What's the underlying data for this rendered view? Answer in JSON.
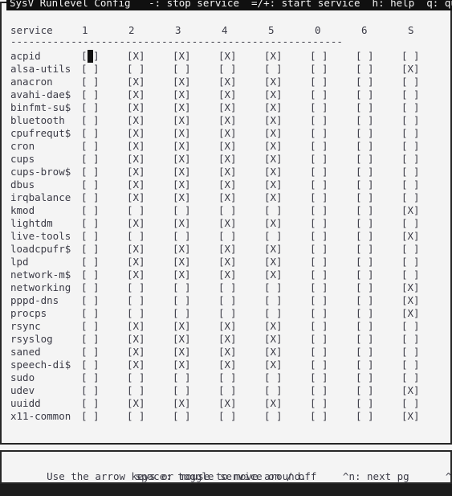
{
  "titlebar": {
    "app_title": "SysV Runlevel Config",
    "hint_stop": "-: stop service",
    "hint_start": "=/+: start service",
    "hint_help": "h: help",
    "hint_quit": "q: quit",
    "full_text": "SysV Runlevel Config   -: stop service  =/+: start service  h: help  q: quit",
    "background_color": "#101010",
    "text_color": "#f4f4f4"
  },
  "table": {
    "name_header": "service",
    "columns": [
      "1",
      "2",
      "3",
      "4",
      "5",
      "0",
      "6",
      "S"
    ],
    "separator": "-------------------------------------------------------",
    "checked_glyph": "[X]",
    "unchecked_glyph": "[ ]",
    "cursor": {
      "row": "acpid",
      "column": "1"
    },
    "rows": [
      {
        "service": "acpid",
        "states": [
          0,
          1,
          1,
          1,
          1,
          0,
          0,
          0
        ]
      },
      {
        "service": "alsa-utils",
        "states": [
          0,
          0,
          0,
          0,
          0,
          0,
          0,
          1
        ]
      },
      {
        "service": "anacron",
        "states": [
          0,
          1,
          1,
          1,
          1,
          0,
          0,
          0
        ]
      },
      {
        "service": "avahi-dae$",
        "states": [
          0,
          1,
          1,
          1,
          1,
          0,
          0,
          0
        ]
      },
      {
        "service": "binfmt-su$",
        "states": [
          0,
          1,
          1,
          1,
          1,
          0,
          0,
          0
        ]
      },
      {
        "service": "bluetooth",
        "states": [
          0,
          1,
          1,
          1,
          1,
          0,
          0,
          0
        ]
      },
      {
        "service": "cpufrequt$",
        "states": [
          0,
          1,
          1,
          1,
          1,
          0,
          0,
          0
        ]
      },
      {
        "service": "cron",
        "states": [
          0,
          1,
          1,
          1,
          1,
          0,
          0,
          0
        ]
      },
      {
        "service": "cups",
        "states": [
          0,
          1,
          1,
          1,
          1,
          0,
          0,
          0
        ]
      },
      {
        "service": "cups-brow$",
        "states": [
          0,
          1,
          1,
          1,
          1,
          0,
          0,
          0
        ]
      },
      {
        "service": "dbus",
        "states": [
          0,
          1,
          1,
          1,
          1,
          0,
          0,
          0
        ]
      },
      {
        "service": "irqbalance",
        "states": [
          0,
          1,
          1,
          1,
          1,
          0,
          0,
          0
        ]
      },
      {
        "service": "kmod",
        "states": [
          0,
          0,
          0,
          0,
          0,
          0,
          0,
          1
        ]
      },
      {
        "service": "lightdm",
        "states": [
          0,
          1,
          1,
          1,
          1,
          0,
          0,
          0
        ]
      },
      {
        "service": "live-tools",
        "states": [
          0,
          0,
          0,
          0,
          0,
          0,
          0,
          1
        ]
      },
      {
        "service": "loadcpufr$",
        "states": [
          0,
          1,
          1,
          1,
          1,
          0,
          0,
          0
        ]
      },
      {
        "service": "lpd",
        "states": [
          0,
          1,
          1,
          1,
          1,
          0,
          0,
          0
        ]
      },
      {
        "service": "network-m$",
        "states": [
          0,
          1,
          1,
          1,
          1,
          0,
          0,
          0
        ]
      },
      {
        "service": "networking",
        "states": [
          0,
          0,
          0,
          0,
          0,
          0,
          0,
          1
        ]
      },
      {
        "service": "pppd-dns",
        "states": [
          0,
          0,
          0,
          0,
          0,
          0,
          0,
          1
        ]
      },
      {
        "service": "procps",
        "states": [
          0,
          0,
          0,
          0,
          0,
          0,
          0,
          1
        ]
      },
      {
        "service": "rsync",
        "states": [
          0,
          1,
          1,
          1,
          1,
          0,
          0,
          0
        ]
      },
      {
        "service": "rsyslog",
        "states": [
          0,
          1,
          1,
          1,
          1,
          0,
          0,
          0
        ]
      },
      {
        "service": "saned",
        "states": [
          0,
          1,
          1,
          1,
          1,
          0,
          0,
          0
        ]
      },
      {
        "service": "speech-di$",
        "states": [
          0,
          1,
          1,
          1,
          1,
          0,
          0,
          0
        ]
      },
      {
        "service": "sudo",
        "states": [
          0,
          0,
          0,
          0,
          0,
          0,
          0,
          0
        ]
      },
      {
        "service": "udev",
        "states": [
          0,
          0,
          0,
          0,
          0,
          0,
          0,
          1
        ]
      },
      {
        "service": "uuidd",
        "states": [
          0,
          1,
          1,
          1,
          1,
          0,
          0,
          0
        ]
      },
      {
        "service": "x11-common",
        "states": [
          0,
          0,
          0,
          0,
          0,
          0,
          0,
          1
        ]
      }
    ]
  },
  "help": {
    "line1_text": "Use the arrow keys or mouse to move around.",
    "next_page": "^n: next pg",
    "prev_page": "^p: prev pg",
    "line1_full": "Use the arrow keys or mouse to move around.      ^n: next pg      ^p: prev pg",
    "line2": "space: toggle service on / off"
  }
}
